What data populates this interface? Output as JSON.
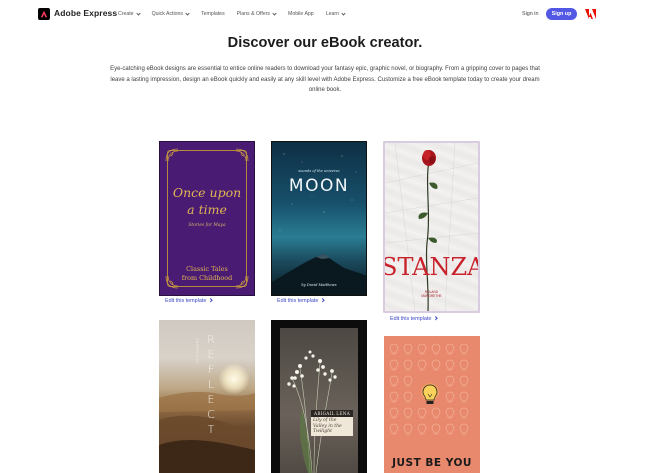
{
  "header": {
    "brand": "Adobe Express",
    "nav": [
      {
        "label": "Create",
        "dropdown": true
      },
      {
        "label": "Quick Actions",
        "dropdown": true
      },
      {
        "label": "Templates",
        "dropdown": false
      },
      {
        "label": "Plans & Offers",
        "dropdown": true
      },
      {
        "label": "Mobile App",
        "dropdown": false
      },
      {
        "label": "Learn",
        "dropdown": true
      }
    ],
    "signin": "Sign in",
    "signup": "Sign up",
    "accent_color": "#5258e4",
    "adobe_red": "#eb1000"
  },
  "main": {
    "title": "Discover our eBook creator.",
    "intro": "Eye-catching eBook designs are essential to entice online readers to download your fantasy epic, graphic novel, or biography. From a gripping cover to pages that leave a lasting impression, design an eBook quickly and easily at any skill level with Adobe Express. Customize a free eBook template today to create your dream online book."
  },
  "templates": [
    {
      "edit_label": "Edit this template",
      "title_line1": "Once upon",
      "title_line2": "a time",
      "subtitle": "Stories for Maya",
      "footer_line1": "Classic Tales",
      "footer_line2": "from Childhood"
    },
    {
      "edit_label": "Edit this template",
      "subtitle": "sounds of the universe",
      "title": "MOON",
      "author": "by David Matthews"
    },
    {
      "edit_label": "Edit this template",
      "title": "STANZA",
      "author_line1": "ROLAND",
      "author_line2": "MARGRETHE"
    },
    {
      "title": "REFLECT",
      "side_text": "CHRONICLES"
    },
    {
      "label1": "ABIGAIL LENA",
      "label2": "Lily of the Valley in the Twilight"
    },
    {
      "title": "JUST BE YOU"
    }
  ]
}
